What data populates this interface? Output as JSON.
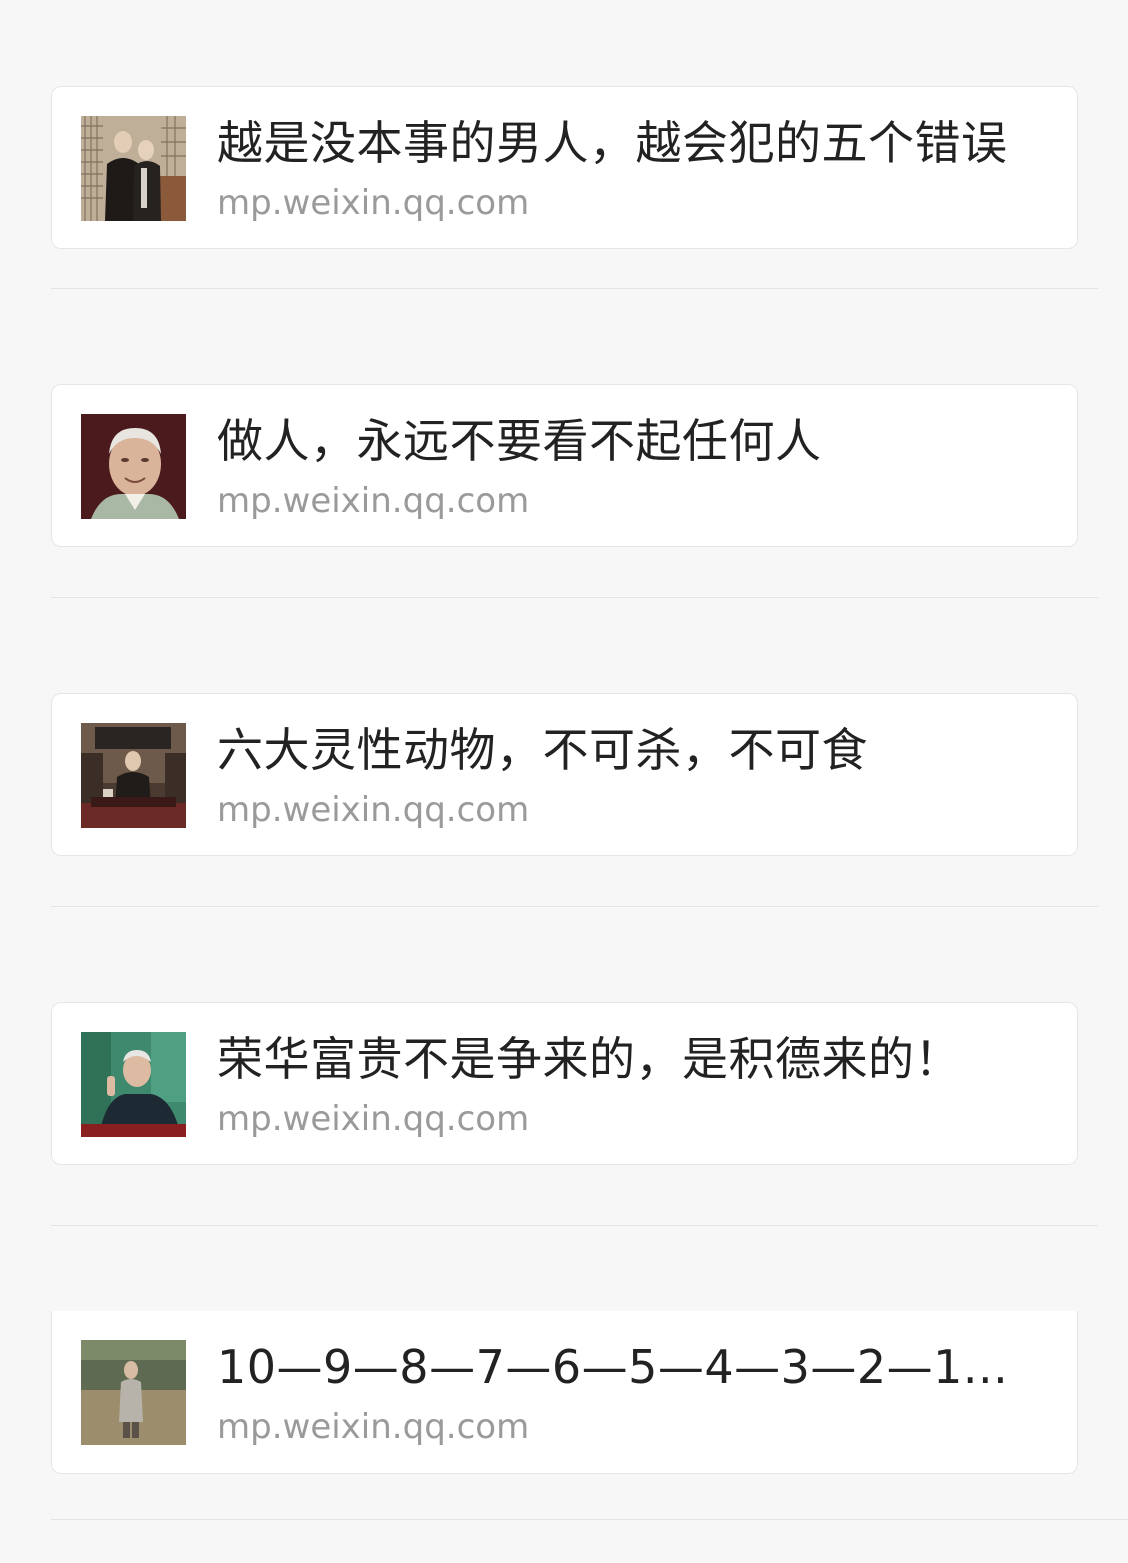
{
  "articles": [
    {
      "title": "越是没本事的男人，越会犯的五个错误",
      "source": "mp.weixin.qq.com",
      "thumbnail": "photo-two-men-standing"
    },
    {
      "title": "做人，永远不要看不起任何人",
      "source": "mp.weixin.qq.com",
      "thumbnail": "photo-elderly-man-portrait"
    },
    {
      "title": "六大灵性动物，不可杀，不可食",
      "source": "mp.weixin.qq.com",
      "thumbnail": "photo-man-seated-at-table"
    },
    {
      "title": "荣华富贵不是争来的，是积德来的！",
      "source": "mp.weixin.qq.com",
      "thumbnail": "photo-elderly-man-speaking"
    },
    {
      "title": "10—9—8—7—6—5—4—3—2—1...",
      "source": "mp.weixin.qq.com",
      "thumbnail": "photo-man-standing-outdoors"
    }
  ],
  "colors": {
    "background": "#f7f7f7",
    "card": "#ffffff",
    "title_text": "#222222",
    "source_text": "#9a9a9a",
    "divider": "#e3e3e3"
  }
}
